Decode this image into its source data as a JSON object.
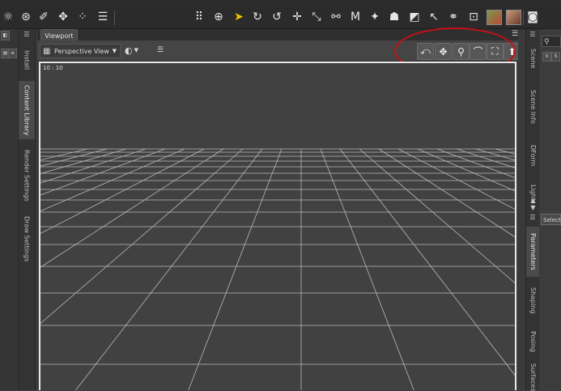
{
  "toolbar": {
    "icons": [
      "sun-icon",
      "dial-icon",
      "wand-icon",
      "universal-tool-icon",
      "node-select-icon",
      "list-icon",
      "grid-dots-icon",
      "move-target-icon",
      "pointer-icon",
      "rotate-icon",
      "twist-icon",
      "translate-icon",
      "scale-icon",
      "joint-editor-icon",
      "region-nav-icon",
      "figure-tool-icon",
      "person-tool-icon",
      "camera-light-icon",
      "posing-arrow-icon",
      "geometry-icon",
      "lock-icon",
      "render-preview-icon",
      "portrait-render-icon",
      "camera-icon"
    ]
  },
  "left_panel": {
    "tabs": [
      "Install",
      "Content Library",
      "Render Settings",
      "Draw Settings"
    ],
    "active_tab": "Content Library"
  },
  "viewport": {
    "tab_label": "Viewport",
    "view_menu": "Perspective View",
    "aspect_label": "10 : 10",
    "nav_buttons": [
      "orbit-icon",
      "pan-icon",
      "zoom-icon",
      "roll-icon",
      "frame-icon",
      "reset-view-icon"
    ]
  },
  "right_panel": {
    "top_tabs": [
      "Scene",
      "Scene Info",
      "DForm",
      "Light"
    ],
    "bottom_tabs": [
      "Parameters",
      "Shaping",
      "Posing",
      "Surfaces"
    ],
    "active_tab": "Parameters",
    "select_label": "Select",
    "top_button_labels": [
      "V",
      "S"
    ]
  },
  "colors": {
    "annotation": "#c8101a",
    "pointer_highlight": "#f2c400",
    "canvas_border": "#e8e8e8"
  }
}
